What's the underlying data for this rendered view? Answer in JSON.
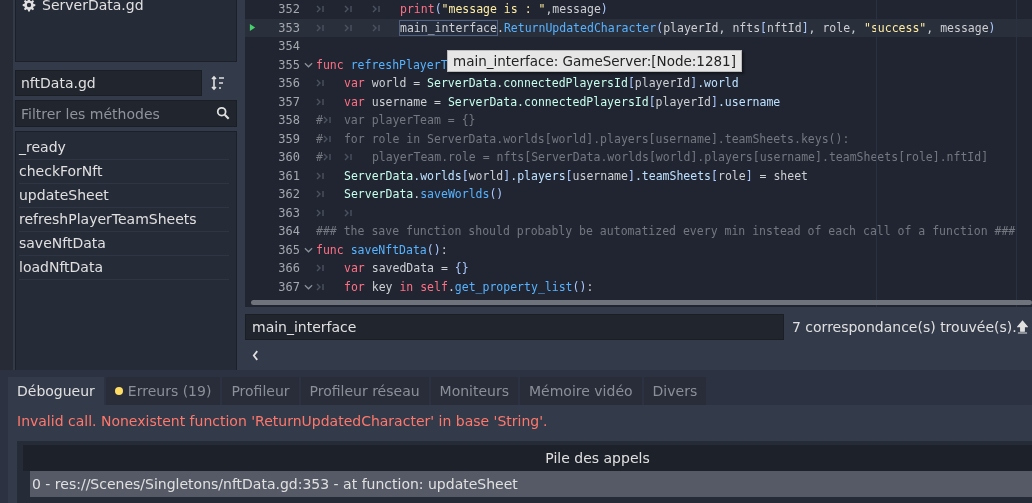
{
  "file_list": {
    "items": [
      {
        "label": "ServerData.gd",
        "selected": false
      }
    ]
  },
  "script_name": "nftData.gd",
  "method_filter": {
    "placeholder": "Filtrer les méthodes"
  },
  "methods": [
    {
      "label": "_ready",
      "selected": false
    },
    {
      "label": "checkForNft",
      "selected": false
    },
    {
      "label": "updateSheet",
      "selected": false
    },
    {
      "label": "refreshPlayerTeamSheets",
      "selected": false
    },
    {
      "label": "saveNftData",
      "selected": false
    },
    {
      "label": "loadNftData",
      "selected": false
    }
  ],
  "editor": {
    "lines": [
      {
        "number": "352",
        "current": false,
        "foldable": false,
        "tokens": [
          {
            "kind": "tab"
          },
          {
            "kind": "tab"
          },
          {
            "kind": "tab"
          },
          {
            "kind": "kw",
            "text": "print"
          },
          {
            "kind": "br",
            "text": "("
          },
          {
            "kind": "str",
            "text": "\"message is : \""
          },
          {
            "kind": "id",
            "text": ",message"
          },
          {
            "kind": "br",
            "text": ")"
          }
        ]
      },
      {
        "number": "353",
        "current": true,
        "foldable": false,
        "tokens": [
          {
            "kind": "tab"
          },
          {
            "kind": "tab"
          },
          {
            "kind": "tab"
          },
          {
            "kind": "match",
            "text": "main_interface"
          },
          {
            "kind": "id",
            "text": "."
          },
          {
            "kind": "fn",
            "text": "ReturnUpdatedCharacter"
          },
          {
            "kind": "br",
            "text": "("
          },
          {
            "kind": "id",
            "text": "playerId, nfts"
          },
          {
            "kind": "br",
            "text": "["
          },
          {
            "kind": "id",
            "text": "nftId"
          },
          {
            "kind": "br",
            "text": "]"
          },
          {
            "kind": "id",
            "text": ", role, "
          },
          {
            "kind": "str",
            "text": "\"success\""
          },
          {
            "kind": "id",
            "text": ", message"
          },
          {
            "kind": "br",
            "text": ")"
          }
        ]
      },
      {
        "number": "354",
        "current": false,
        "foldable": false
      },
      {
        "number": "355",
        "current": false,
        "foldable": true,
        "tokens": [
          {
            "kind": "kw",
            "text": "func "
          },
          {
            "kind": "fn",
            "text": "refreshPlayerT"
          }
        ]
      },
      {
        "number": "356",
        "current": false,
        "foldable": false,
        "tokens": [
          {
            "kind": "tab"
          },
          {
            "kind": "kw",
            "text": "var "
          },
          {
            "kind": "id",
            "text": "world = "
          },
          {
            "kind": "cls",
            "text": "ServerData.connectedPlayersId"
          },
          {
            "kind": "br",
            "text": "["
          },
          {
            "kind": "id",
            "text": "playerId"
          },
          {
            "kind": "br",
            "text": "]"
          },
          {
            "kind": "member",
            "text": ".world"
          }
        ]
      },
      {
        "number": "357",
        "current": false,
        "foldable": false,
        "tokens": [
          {
            "kind": "tab"
          },
          {
            "kind": "kw",
            "text": "var "
          },
          {
            "kind": "id",
            "text": "username = "
          },
          {
            "kind": "cls",
            "text": "ServerData.connectedPlayersId"
          },
          {
            "kind": "br",
            "text": "["
          },
          {
            "kind": "id",
            "text": "playerId"
          },
          {
            "kind": "br",
            "text": "]"
          },
          {
            "kind": "member",
            "text": ".username"
          }
        ]
      },
      {
        "number": "358",
        "current": false,
        "foldable": false,
        "tokens": [
          {
            "kind": "cm",
            "text": "#"
          },
          {
            "kind": "ctab"
          },
          {
            "kind": "cm",
            "text": "var playerTeam = {}"
          }
        ]
      },
      {
        "number": "359",
        "current": false,
        "foldable": false,
        "tokens": [
          {
            "kind": "cm",
            "text": "#"
          },
          {
            "kind": "ctab"
          },
          {
            "kind": "cm",
            "text": "for role in ServerData.worlds[world].players[username].teamSheets.keys():"
          }
        ]
      },
      {
        "number": "360",
        "current": false,
        "foldable": false,
        "tokens": [
          {
            "kind": "cm",
            "text": "#"
          },
          {
            "kind": "ctab"
          },
          {
            "kind": "tab"
          },
          {
            "kind": "cm",
            "text": "playerTeam.role = nfts[ServerData.worlds[world].players[username].teamSheets[role].nftId]"
          }
        ]
      },
      {
        "number": "361",
        "current": false,
        "foldable": false,
        "tokens": [
          {
            "kind": "tab"
          },
          {
            "kind": "cls",
            "text": "ServerData"
          },
          {
            "kind": "member",
            "text": ".worlds"
          },
          {
            "kind": "br",
            "text": "["
          },
          {
            "kind": "id",
            "text": "world"
          },
          {
            "kind": "br",
            "text": "]"
          },
          {
            "kind": "member",
            "text": ".players"
          },
          {
            "kind": "br",
            "text": "["
          },
          {
            "kind": "id",
            "text": "username"
          },
          {
            "kind": "br",
            "text": "]"
          },
          {
            "kind": "member",
            "text": ".teamSheets"
          },
          {
            "kind": "br",
            "text": "["
          },
          {
            "kind": "id",
            "text": "role"
          },
          {
            "kind": "br",
            "text": "]"
          },
          {
            "kind": "id",
            "text": " = sheet"
          }
        ]
      },
      {
        "number": "362",
        "current": false,
        "foldable": false,
        "tokens": [
          {
            "kind": "tab"
          },
          {
            "kind": "cls",
            "text": "ServerData"
          },
          {
            "kind": "id",
            "text": "."
          },
          {
            "kind": "fn",
            "text": "saveWorlds"
          },
          {
            "kind": "br",
            "text": "()"
          }
        ]
      },
      {
        "number": "363",
        "current": false,
        "foldable": false,
        "tokens": [
          {
            "kind": "tab"
          },
          {
            "kind": "tab"
          }
        ]
      },
      {
        "number": "364",
        "current": false,
        "foldable": false,
        "tokens": [
          {
            "kind": "cm",
            "text": "### the save function should probably be automatized every min instead of each call of a function ###"
          }
        ]
      },
      {
        "number": "365",
        "current": false,
        "foldable": true,
        "tokens": [
          {
            "kind": "kw",
            "text": "func "
          },
          {
            "kind": "fn",
            "text": "saveNftData"
          },
          {
            "kind": "br",
            "text": "()"
          },
          {
            "kind": "id",
            "text": ":"
          }
        ]
      },
      {
        "number": "366",
        "current": false,
        "foldable": false,
        "tokens": [
          {
            "kind": "tab"
          },
          {
            "kind": "kw",
            "text": "var "
          },
          {
            "kind": "id",
            "text": "savedData = "
          },
          {
            "kind": "br",
            "text": "{}"
          }
        ]
      },
      {
        "number": "367",
        "current": false,
        "foldable": true,
        "tokens": [
          {
            "kind": "tab"
          },
          {
            "kind": "kw",
            "text": "for "
          },
          {
            "kind": "id",
            "text": "key "
          },
          {
            "kind": "kw",
            "text": "in self"
          },
          {
            "kind": "id",
            "text": "."
          },
          {
            "kind": "fn",
            "text": "get_property_list"
          },
          {
            "kind": "br",
            "text": "()"
          },
          {
            "kind": "id",
            "text": ":"
          }
        ]
      }
    ]
  },
  "tooltip": {
    "text": "main_interface: GameServer:[Node:1281]"
  },
  "search": {
    "value": "main_interface",
    "result": "7 correspondance(s) trouvée(s)."
  },
  "bottom_tabs": [
    {
      "label": "Débogueur",
      "selected": true,
      "has_errors": false
    },
    {
      "label": "Erreurs (19)",
      "selected": false,
      "has_errors": true
    },
    {
      "label": "Profileur",
      "selected": false,
      "has_errors": false
    },
    {
      "label": "Profileur réseau",
      "selected": false,
      "has_errors": false
    },
    {
      "label": "Moniteurs",
      "selected": false,
      "has_errors": false
    },
    {
      "label": "Mémoire vidéo",
      "selected": false,
      "has_errors": false
    },
    {
      "label": "Divers",
      "selected": false,
      "has_errors": false
    }
  ],
  "error_message": "Invalid call. Nonexistent function 'ReturnUpdatedCharacter' in base 'String'.",
  "call_stack": {
    "title": "Pile des appels",
    "frames": [
      {
        "text": "0 - res://Scenes/Singletons/nftData.gd:353 - at function: updateSheet",
        "selected": true
      }
    ]
  }
}
